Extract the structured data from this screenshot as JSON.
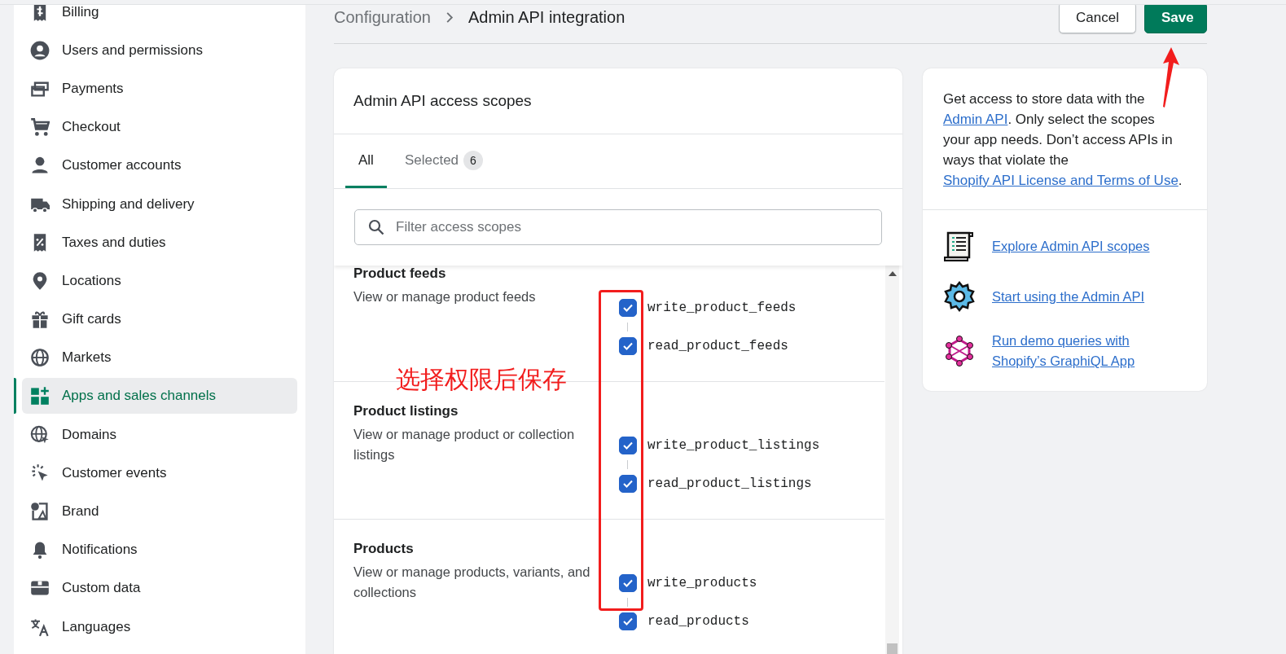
{
  "sidebar": {
    "items": [
      {
        "label": "Billing",
        "selected": false
      },
      {
        "label": "Users and permissions",
        "selected": false
      },
      {
        "label": "Payments",
        "selected": false
      },
      {
        "label": "Checkout",
        "selected": false
      },
      {
        "label": "Customer accounts",
        "selected": false
      },
      {
        "label": "Shipping and delivery",
        "selected": false
      },
      {
        "label": "Taxes and duties",
        "selected": false
      },
      {
        "label": "Locations",
        "selected": false
      },
      {
        "label": "Gift cards",
        "selected": false
      },
      {
        "label": "Markets",
        "selected": false
      },
      {
        "label": "Apps and sales channels",
        "selected": true
      },
      {
        "label": "Domains",
        "selected": false
      },
      {
        "label": "Customer events",
        "selected": false
      },
      {
        "label": "Brand",
        "selected": false
      },
      {
        "label": "Notifications",
        "selected": false
      },
      {
        "label": "Custom data",
        "selected": false
      },
      {
        "label": "Languages",
        "selected": false
      }
    ]
  },
  "breadcrumb": [
    "Configuration",
    "Admin API integration"
  ],
  "actions": [
    {
      "label": "Cancel",
      "kind": "secondary"
    },
    {
      "label": "Save",
      "kind": "primary"
    }
  ],
  "scopes_card": {
    "title": "Admin API access scopes",
    "tabs": [
      {
        "label": "All",
        "selected": true
      },
      {
        "label": "Selected",
        "count": "6",
        "selected": false
      }
    ],
    "search": {
      "placeholder": "Filter access scopes"
    },
    "sections": [
      {
        "title": "Product feeds",
        "description": "View or manage product feeds",
        "scopes": [
          {
            "name": "write_product_feeds",
            "checked": true
          },
          {
            "name": "read_product_feeds",
            "checked": true
          }
        ]
      },
      {
        "title": "Product listings",
        "description": "View or manage product or collection listings",
        "scopes": [
          {
            "name": "write_product_listings",
            "checked": true
          },
          {
            "name": "read_product_listings",
            "checked": true
          }
        ]
      },
      {
        "title": "Products",
        "description": "View or manage products, variants, and collections",
        "scopes": [
          {
            "name": "write_products",
            "checked": true
          },
          {
            "name": "read_products",
            "checked": true
          }
        ]
      }
    ]
  },
  "info_card": {
    "paragraph": [
      {
        "kind": "text",
        "text": "Get access to store data with the "
      },
      {
        "kind": "link",
        "text": "Admin API"
      },
      {
        "kind": "text",
        "text": ". Only select the scopes your app needs. Don’t access APIs in ways that violate the "
      },
      {
        "kind": "link",
        "text": "Shopify API License and Terms of Use"
      },
      {
        "kind": "text",
        "text": "."
      }
    ],
    "resources": [
      {
        "label": "Explore Admin API scopes"
      },
      {
        "label": "Start using the Admin API"
      },
      {
        "label": "Run demo queries with Shopify’s GraphiQL App"
      }
    ]
  },
  "annotation": {
    "text": "选择权限后保存"
  }
}
